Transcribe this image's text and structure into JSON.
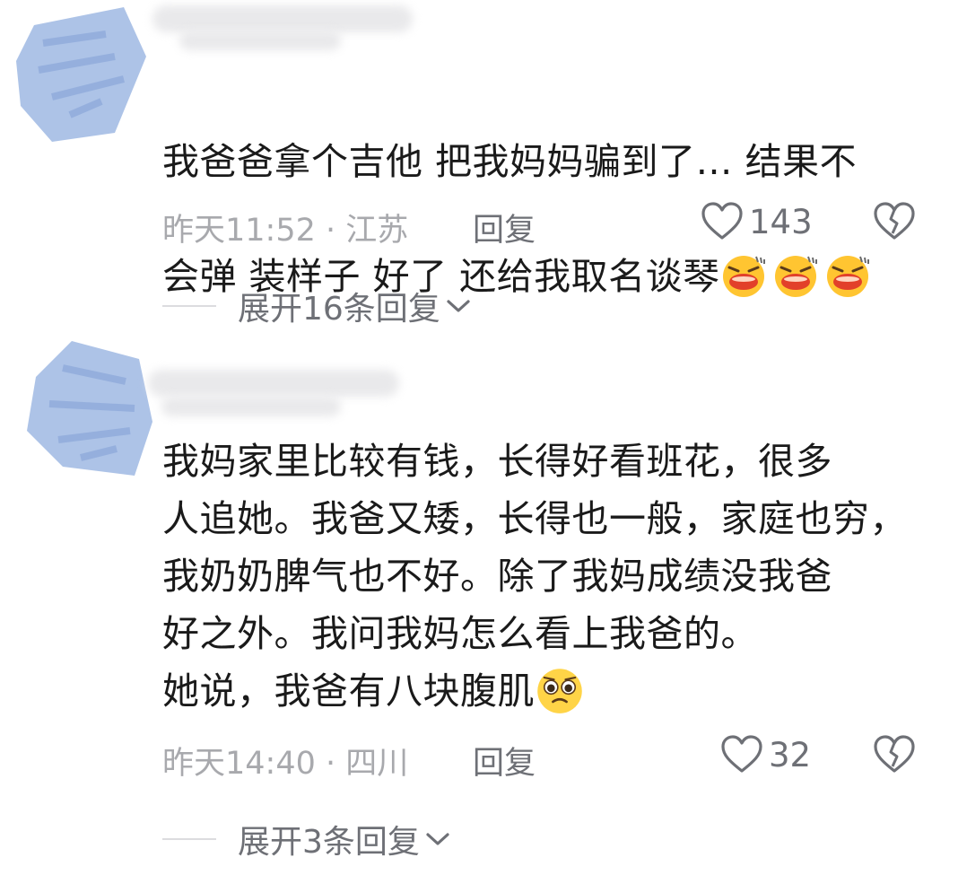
{
  "comments": [
    {
      "text_line1": "我爸爸拿个吉他 把我妈妈骗到了… 结果不",
      "text_line2": "会弹 装样子 好了 还给我取名谈琴",
      "emoji": "laughing-face-emoji",
      "emoji_count": 3,
      "time_location": "昨天11:52 · 江苏",
      "reply_label": "回复",
      "like_count": "143",
      "expand_label": "展开16条回复"
    },
    {
      "text": "我妈家里比较有钱，长得好看班花，很多\n人追她。我爸又矮，长得也一般，家庭也穷，\n我奶奶脾气也不好。除了我妈成绩没我爸\n好之外。我问我妈怎么看上我爸的。\n她说，我爸有八块腹肌",
      "emoji": "pleading-face-emoji",
      "time_location": "昨天14:40 · 四川",
      "reply_label": "回复",
      "like_count": "32",
      "expand_label": "展开3条回复"
    }
  ],
  "icons": {
    "like": "heart-outline-icon",
    "dislike": "broken-heart-icon",
    "expand": "chevron-down-icon"
  },
  "colors": {
    "avatar_overlay": "#a9c0e6",
    "meta_gray": "#a8a9ad",
    "action_gray": "#6e7076"
  }
}
